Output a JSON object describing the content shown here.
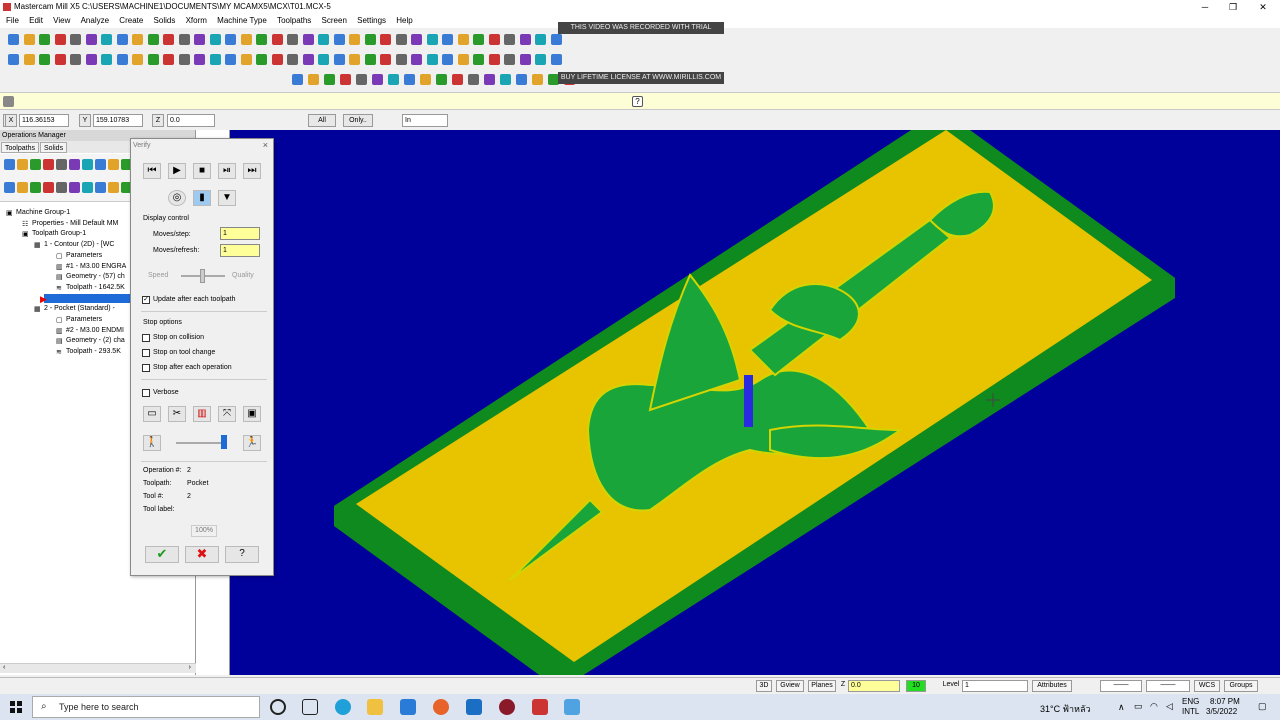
{
  "window": {
    "title": "Mastercam Mill X5  C:\\USERS\\MACHINE1\\DOCUMENTS\\MY MCAMX5\\MCX\\T01.MCX-5",
    "minimize": "─",
    "restore": "❐",
    "close": "✕"
  },
  "menu": [
    "File",
    "Edit",
    "View",
    "Analyze",
    "Create",
    "Solids",
    "Xform",
    "Machine Type",
    "Toolpaths",
    "Screen",
    "Settings",
    "Help"
  ],
  "watermark": {
    "line1": "THIS VIDEO WAS RECORDED WITH TRIAL VERSION",
    "line2": "BUY LIFETIME LICENSE AT WWW.MIRILLIS.COM"
  },
  "coords": {
    "x_label": "X",
    "x_value": "116.36153",
    "y_label": "Y",
    "y_value": "159.10783",
    "z_label": "Z",
    "z_value": "0.0",
    "all_btn": "All",
    "only_btn": "Only..",
    "units": "In"
  },
  "ops_manager": {
    "title": "Operations Manager",
    "tabs": [
      "Toolpaths",
      "Solids"
    ],
    "tree": [
      {
        "indent": 6,
        "label": "Machine Group-1"
      },
      {
        "indent": 22,
        "label": "Properties - Mill Default MM"
      },
      {
        "indent": 22,
        "label": "Toolpath Group-1"
      },
      {
        "indent": 34,
        "label": "1 - Contour (2D) - [WC"
      },
      {
        "indent": 56,
        "label": "Parameters"
      },
      {
        "indent": 56,
        "label": "#1 - M3.00 ENGRA"
      },
      {
        "indent": 56,
        "label": "Geometry - (57) ch"
      },
      {
        "indent": 56,
        "label": "Toolpath - 1642.5K"
      },
      {
        "indent": 34,
        "label": ""
      },
      {
        "indent": 34,
        "label": "2 - Pocket (Standard) -"
      },
      {
        "indent": 56,
        "label": "Parameters"
      },
      {
        "indent": 56,
        "label": "#2 - M3.00 ENDMI"
      },
      {
        "indent": 56,
        "label": "Geometry - (2) cha"
      },
      {
        "indent": 56,
        "label": "Toolpath - 293.5K"
      }
    ]
  },
  "verify": {
    "title": "Verify",
    "close": "×",
    "display_control": "Display control",
    "moves_step_label": "Moves/step:",
    "moves_step_value": "1",
    "moves_refresh_label": "Moves/refresh:",
    "moves_refresh_value": "1",
    "speed": "Speed",
    "quality": "Quality",
    "update_after": "Update after each toolpath",
    "stop_options": "Stop options",
    "stop_collision": "Stop on collision",
    "stop_tool_change": "Stop on tool change",
    "stop_each_op": "Stop after each operation",
    "verbose": "Verbose",
    "operation_label": "Operation #:",
    "operation_value": "2",
    "toolpath_label": "Toolpath:",
    "toolpath_value": "Pocket",
    "tool_label": "Tool #:",
    "tool_value": "2",
    "tool_label_label": "Tool label:",
    "progress": "100%",
    "ok": "✔",
    "cancel": "✖",
    "help": "?"
  },
  "statusbar": {
    "b3d": "3D",
    "gview": "Gview",
    "planes": "Planes",
    "z": "Z",
    "z_value": "0.0",
    "color_value": "10",
    "level": "Level",
    "level_value": "1",
    "attributes": "Attributes",
    "wcs": "WCS",
    "groups": "Groups"
  },
  "taskbar": {
    "search_placeholder": "Type here to search",
    "temp": "31°C ฟ้าหลัว",
    "lang1": "ENG",
    "lang2": "INTL",
    "time": "8:07 PM",
    "date": "3/5/2022"
  },
  "colors": {
    "viewport": "#00009a",
    "stock_top": "#e8c400",
    "stock_side": "#0f8a1e",
    "part": "#1aa53a",
    "outline": "#d4d400",
    "tool": "#2a2ae0"
  }
}
